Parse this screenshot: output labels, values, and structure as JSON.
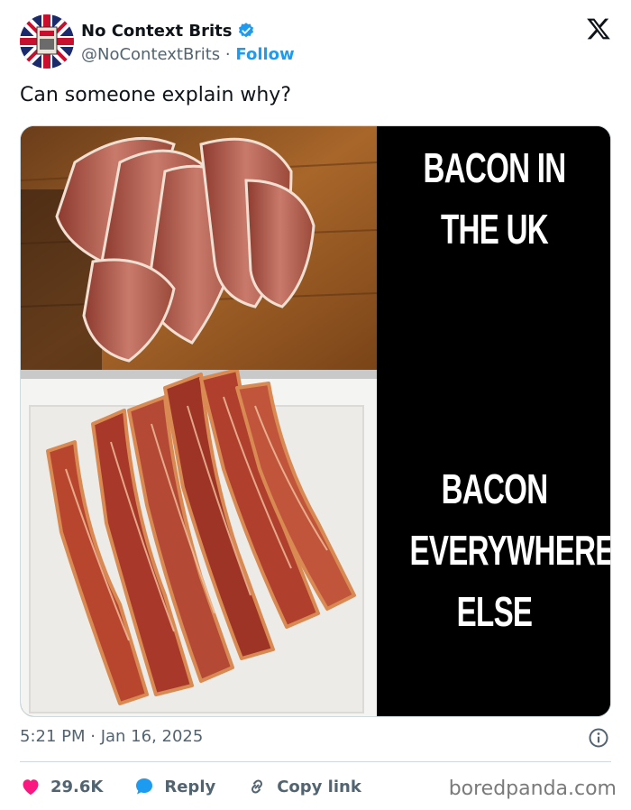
{
  "author": {
    "display_name": "No Context Brits",
    "handle": "@NoContextBrits",
    "separator": "·",
    "follow_label": "Follow"
  },
  "tweet": {
    "text": "Can someone explain why?"
  },
  "meme": {
    "top_caption": "BACON IN THE UK",
    "bottom_caption": "BACON EVERYWHERE ELSE"
  },
  "meta": {
    "timestamp": "5:21 PM · Jan 16, 2025"
  },
  "actions": {
    "likes": "29.6K",
    "reply_label": "Reply",
    "copy_link_label": "Copy link"
  },
  "watermark": "boredpanda.com",
  "icons": [
    "verified-badge-icon",
    "x-logo-icon",
    "info-icon",
    "heart-icon",
    "reply-bubble-icon",
    "link-icon"
  ],
  "colors": {
    "accent": "#1d9bf0",
    "like": "#f91880",
    "text": "#0f1419",
    "muted": "#536471"
  }
}
